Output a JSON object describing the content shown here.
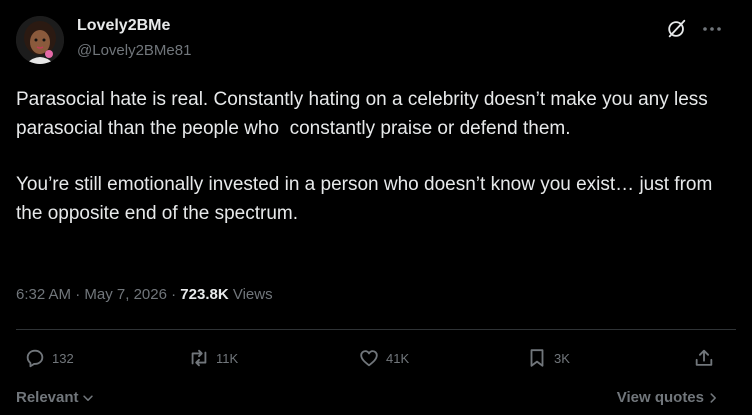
{
  "author": {
    "display_name": "Lovely2BMe",
    "handle": "@Lovely2BMe81",
    "avatar_icon": "avatar-cartoon-woman"
  },
  "header": {
    "grok_icon": "grok-icon",
    "more_icon": "more-icon"
  },
  "post": {
    "paragraphs": [
      "Parasocial hate is real. Constantly hating on a celebrity doesn’t make you any less parasocial than the people who  constantly praise or defend them.",
      "You’re still emotionally invested in a person who doesn’t know you exist… just from the opposite end of the spectrum."
    ],
    "time": "6:32 AM",
    "separator": "·",
    "date": "May 7, 2026",
    "views_count": "723.8K",
    "views_label": "Views"
  },
  "actions": {
    "replies": "132",
    "reposts": "11K",
    "likes": "41K",
    "bookmarks": "3K"
  },
  "footer": {
    "sort_label": "Relevant",
    "quotes_label": "View quotes"
  },
  "colors": {
    "background": "#000000",
    "text": "#e7e9ea",
    "muted": "#71767b",
    "divider": "#2f3336"
  }
}
